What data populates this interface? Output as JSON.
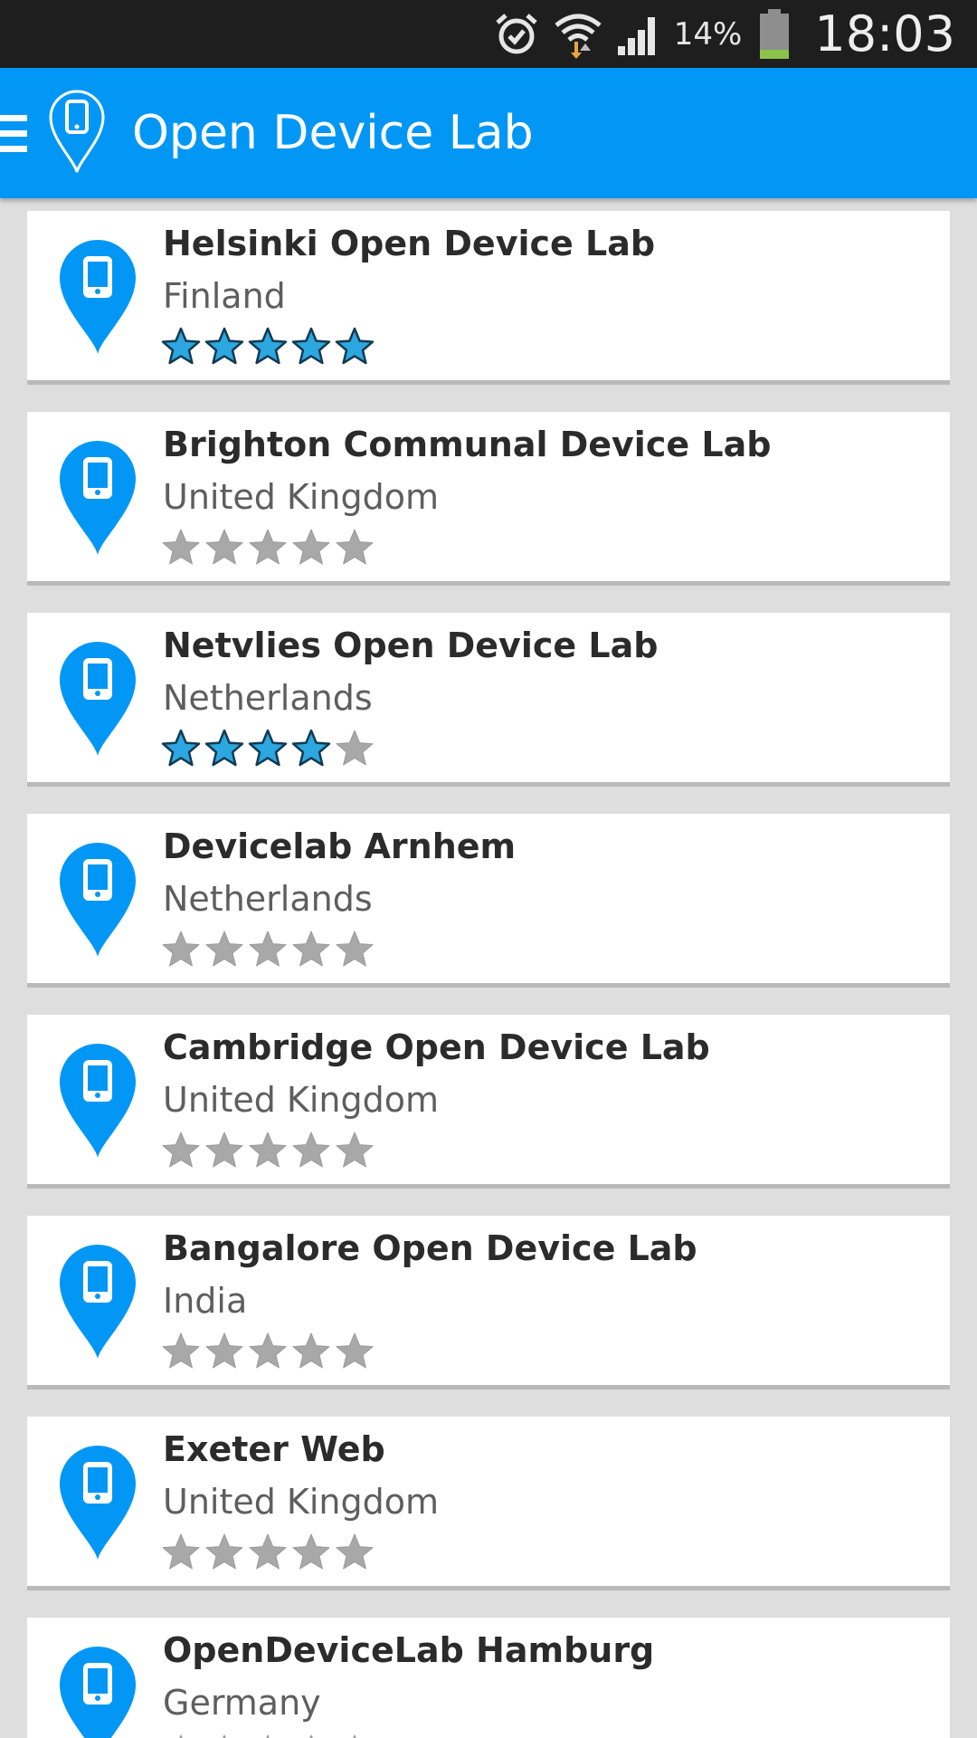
{
  "status_bar": {
    "battery_text": "14%",
    "time": "18:03",
    "icons": [
      "alarm-icon",
      "wifi-icon",
      "signal-icon",
      "battery-icon"
    ]
  },
  "app_bar": {
    "title": "Open Device Lab",
    "color": "#0397f5"
  },
  "colors": {
    "star_filled": "#2ca7df",
    "star_empty": "#a8a8a8",
    "pin": "#0397f5"
  },
  "labs": [
    {
      "name": "Helsinki Open Device Lab",
      "country": "Finland",
      "rating": 5
    },
    {
      "name": "Brighton Communal Device Lab",
      "country": "United Kingdom",
      "rating": 0
    },
    {
      "name": "Netvlies Open Device Lab",
      "country": "Netherlands",
      "rating": 4
    },
    {
      "name": "Devicelab Arnhem",
      "country": "Netherlands",
      "rating": 0
    },
    {
      "name": "Cambridge Open Device Lab",
      "country": "United Kingdom",
      "rating": 0
    },
    {
      "name": "Bangalore Open Device Lab",
      "country": "India",
      "rating": 0
    },
    {
      "name": "Exeter Web",
      "country": "United Kingdom",
      "rating": 0
    },
    {
      "name": "OpenDeviceLab Hamburg",
      "country": "Germany",
      "rating": 0
    }
  ]
}
